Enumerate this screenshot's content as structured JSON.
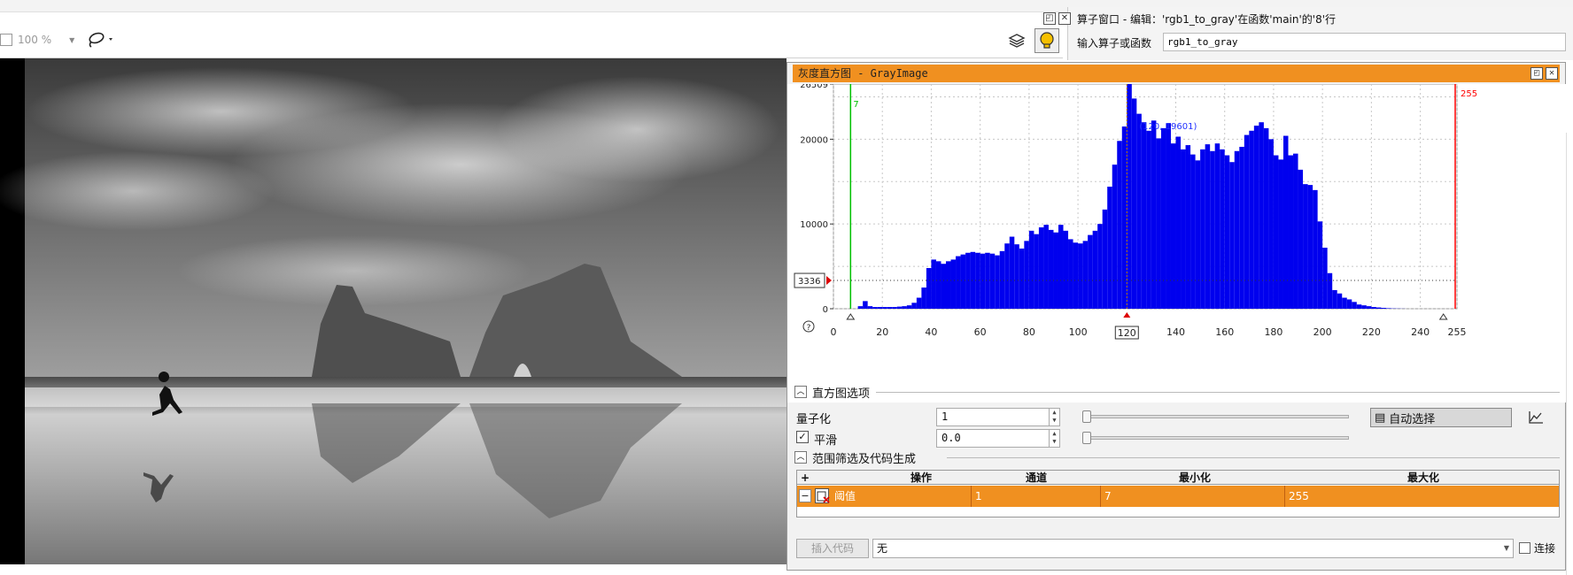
{
  "toolbar": {
    "zoom_value": "100 %",
    "icons": [
      "zoom-icon",
      "lasso-icon",
      "layers-icon",
      "lightbulb-icon"
    ]
  },
  "operator_window": {
    "title": "算子窗口 - 编辑：'rgb1_to_gray'在函数'main'的'8'行",
    "input_label": "输入算子或函数",
    "input_value": "rgb1_to_gray"
  },
  "histogram_window": {
    "title": "灰度直方图 - GrayImage",
    "section_options": "直方图选项",
    "quantize_label": "量子化",
    "quantize_value": "1",
    "auto_select_label": "自动选择",
    "smooth_label": "平滑",
    "smooth_checked": true,
    "smooth_value": "0.0",
    "section_range": "范围筛选及代码生成",
    "table": {
      "add_symbol": "+",
      "columns": [
        "操作",
        "通道",
        "最小化",
        "最大化"
      ],
      "rows": [
        {
          "remove": "−",
          "operation": "阈值",
          "channel": "1",
          "min": "7",
          "max": "255"
        }
      ]
    },
    "insert_code_label": "插入代码",
    "combo_value": "无",
    "connect_label": "连接"
  },
  "chart_data": {
    "type": "bar",
    "title": "",
    "xlabel": "",
    "ylabel": "",
    "xlim": [
      0,
      255
    ],
    "ylim": [
      0,
      26509
    ],
    "x_ticks": [
      "0",
      "20",
      "40",
      "60",
      "80",
      "100",
      "120",
      "140",
      "160",
      "180",
      "200",
      "220",
      "240",
      "255"
    ],
    "y_ticks": [
      "0",
      "10000",
      "20000",
      "26509"
    ],
    "y_max_label": "26509",
    "threshold_min": 7,
    "threshold_max": 255,
    "marker_x": 120,
    "marker_x_label": "120",
    "h_marker_value": 3336,
    "h_marker_label": "3336",
    "annotation": "(120, 19601)",
    "min_label": "7",
    "max_label": "255",
    "colors": {
      "bars": "#0000ee",
      "min_line": "#00c000",
      "max_line": "#ff0000",
      "grid": "#c8c8c8"
    },
    "x": [
      0,
      2,
      4,
      6,
      8,
      10,
      12,
      14,
      16,
      18,
      20,
      22,
      24,
      26,
      28,
      30,
      32,
      34,
      36,
      38,
      40,
      42,
      44,
      46,
      48,
      50,
      52,
      54,
      56,
      58,
      60,
      62,
      64,
      66,
      68,
      70,
      72,
      74,
      76,
      78,
      80,
      82,
      84,
      86,
      88,
      90,
      92,
      94,
      96,
      98,
      100,
      102,
      104,
      106,
      108,
      110,
      112,
      114,
      116,
      118,
      120,
      122,
      124,
      126,
      128,
      130,
      132,
      134,
      136,
      138,
      140,
      142,
      144,
      146,
      148,
      150,
      152,
      154,
      156,
      158,
      160,
      162,
      164,
      166,
      168,
      170,
      172,
      174,
      176,
      178,
      180,
      182,
      184,
      186,
      188,
      190,
      192,
      194,
      196,
      198,
      200,
      202,
      204,
      206,
      208,
      210,
      212,
      214,
      216,
      218,
      220,
      222,
      224,
      226,
      228,
      230,
      232,
      234,
      236,
      238,
      240,
      242,
      244,
      246,
      248,
      250,
      252,
      254
    ],
    "values": [
      0,
      0,
      0,
      0,
      0,
      300,
      900,
      300,
      200,
      200,
      200,
      200,
      200,
      250,
      300,
      400,
      700,
      1300,
      2500,
      4800,
      5800,
      5600,
      5300,
      5600,
      5800,
      6200,
      6400,
      6600,
      6700,
      6600,
      6500,
      6600,
      6500,
      6300,
      6800,
      7700,
      8500,
      7600,
      7100,
      8000,
      9200,
      8800,
      9600,
      9900,
      9300,
      9000,
      9900,
      9200,
      8200,
      7800,
      7700,
      8000,
      8700,
      9200,
      10000,
      11700,
      14400,
      17000,
      19800,
      21500,
      26509,
      24800,
      23000,
      22000,
      21000,
      22200,
      20100,
      21300,
      21900,
      19500,
      20300,
      18800,
      19300,
      18200,
      17500,
      18800,
      19400,
      18600,
      19500,
      18800,
      18100,
      17300,
      18600,
      19100,
      20500,
      21000,
      21600,
      22000,
      21300,
      20000,
      18100,
      17600,
      20400,
      18100,
      18300,
      16400,
      14700,
      14600,
      14000,
      10300,
      7200,
      4200,
      2200,
      1800,
      1300,
      1100,
      800,
      500,
      400,
      300,
      200,
      150,
      100,
      60,
      30,
      20,
      10,
      0,
      0,
      0,
      0,
      0,
      0,
      0,
      0,
      0,
      0,
      0
    ]
  }
}
